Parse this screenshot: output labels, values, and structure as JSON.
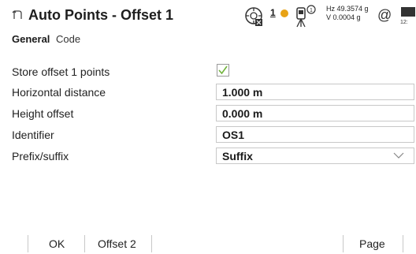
{
  "header": {
    "title": "Auto Points - Offset 1",
    "status": {
      "prism_number": "1",
      "hz_reading": "Hz 49.3574 g",
      "v_reading": "V  0.0004 g",
      "at_symbol": "@"
    },
    "icons": [
      "back-icon",
      "target-icon",
      "prism-icon",
      "instrument-icon",
      "at-icon",
      "battery-icon"
    ]
  },
  "tabs": [
    {
      "label": "General",
      "active": true
    },
    {
      "label": "Code",
      "active": false
    }
  ],
  "form": {
    "store_offset": {
      "label": "Store offset 1 points",
      "checked": true
    },
    "horizontal_distance": {
      "label": "Horizontal distance",
      "value": "1.000 m"
    },
    "height_offset": {
      "label": "Height offset",
      "value": "0.000 m"
    },
    "identifier": {
      "label": "Identifier",
      "value": "OS1"
    },
    "prefix_suffix": {
      "label": "Prefix/suffix",
      "value": "Suffix"
    }
  },
  "softkeys": {
    "ok": "OK",
    "offset2": "Offset 2",
    "page": "Page"
  },
  "colors": {
    "checkbox_mark": "#6fb33a",
    "prism_dot": "#e8a316",
    "field_border": "#c8c8c8"
  }
}
